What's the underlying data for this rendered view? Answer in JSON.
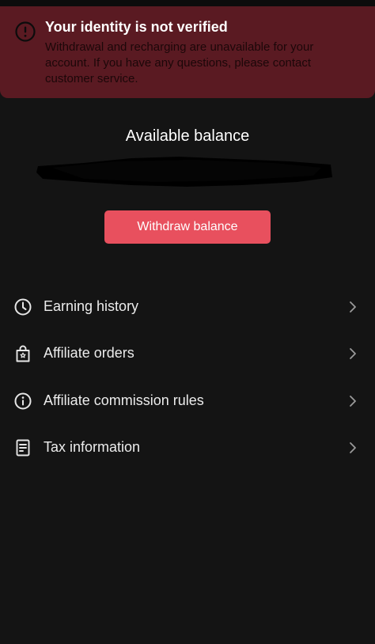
{
  "alert": {
    "title": "Your identity is not verified",
    "message": "Withdrawal and recharging are unavailable for your account. If you have any questions, please contact customer service.",
    "icon": "exclamation-circle-icon",
    "background_color": "#5a1a22"
  },
  "balance": {
    "title": "Available balance",
    "amount_redacted": true,
    "withdraw_label": "Withdraw balance",
    "button_color": "#e8505e"
  },
  "menu": {
    "items": [
      {
        "label": "Earning history",
        "icon": "clock-icon"
      },
      {
        "label": "Affiliate orders",
        "icon": "shopping-bag-icon"
      },
      {
        "label": "Affiliate commission rules",
        "icon": "info-circle-icon"
      },
      {
        "label": "Tax information",
        "icon": "document-icon"
      }
    ],
    "chevron_icon": "chevron-right-icon"
  }
}
